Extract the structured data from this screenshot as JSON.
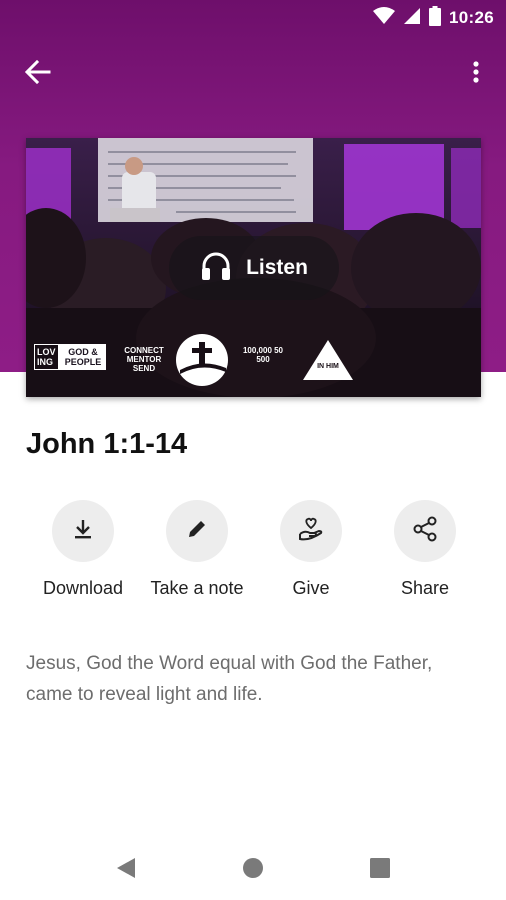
{
  "status_bar": {
    "time": "10:26",
    "icons": [
      "wifi-icon",
      "cell-signal-icon",
      "battery-icon"
    ]
  },
  "app_bar": {
    "back_icon": "arrow-back-icon",
    "menu_icon": "more-vert-icon"
  },
  "hero": {
    "listen_label": "Listen",
    "listen_icon": "headphones-icon",
    "logos": {
      "love_left": "LOV ING",
      "love_right": "GOD & PEOPLE",
      "connect": "CONNECT MENTOR SEND",
      "number": "100,000 50 500",
      "in_him": "IN HIM"
    }
  },
  "sermon": {
    "title": "John 1:1-14",
    "description": "Jesus, God the Word equal with God the Father, came to reveal light and life."
  },
  "actions": [
    {
      "label": "Download",
      "icon": "download-icon"
    },
    {
      "label": "Take a note",
      "icon": "pencil-icon"
    },
    {
      "label": "Give",
      "icon": "giving-hand-heart-icon"
    },
    {
      "label": "Share",
      "icon": "share-icon"
    }
  ],
  "nav_bar": {
    "icons": [
      "nav-back-icon",
      "nav-home-icon",
      "nav-recents-icon"
    ]
  },
  "colors": {
    "header": "#861a80",
    "accent": "#ffffff",
    "action_bg": "#ededed"
  }
}
